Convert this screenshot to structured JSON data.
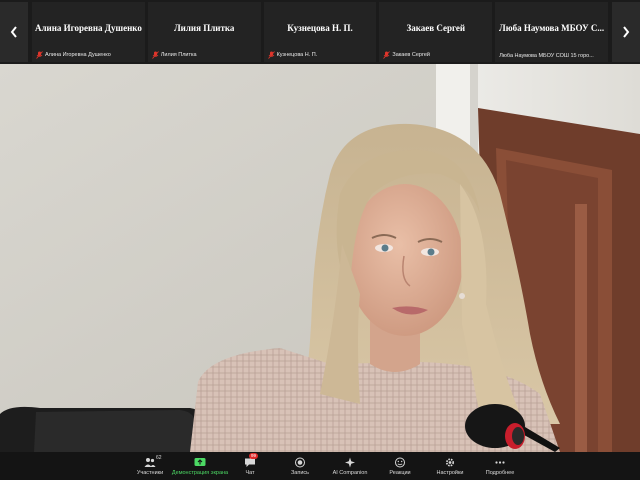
{
  "participants_strip": {
    "prev_icon": "chevron-left-icon",
    "next_icon": "chevron-right-icon",
    "tiles": [
      {
        "display_name": "Алина Игоревна Душенко",
        "label": "Алина Игоревна Душенко",
        "muted": true
      },
      {
        "display_name": "Лилия Плитка",
        "label": "Лилия Плитка",
        "muted": true
      },
      {
        "display_name": "Кузнецова Н. П.",
        "label": "Кузнецова Н. П.",
        "muted": true
      },
      {
        "display_name": "Закаев Сергей",
        "label": "Закаев Сергей",
        "muted": true
      },
      {
        "display_name": "Люба Наумова МБОУ С...",
        "label": "Люба Наумова МБОУ СОШ 15 горо...",
        "muted": false
      }
    ]
  },
  "toolbar": {
    "participants": {
      "label": "Участники",
      "count": "62",
      "icon": "participants-icon"
    },
    "share": {
      "label": "Демонстрация экрана",
      "icon": "share-screen-icon",
      "color": "#4cd964"
    },
    "chat": {
      "label": "Чат",
      "badge": "99",
      "icon": "chat-icon"
    },
    "record": {
      "label": "Запись",
      "icon": "record-icon"
    },
    "ai": {
      "label": "AI Companion",
      "icon": "ai-companion-icon"
    },
    "reactions": {
      "label": "Реакции",
      "icon": "reactions-icon"
    },
    "settings": {
      "label": "Настройки",
      "icon": "gear-icon"
    },
    "more": {
      "label": "Подробнее",
      "icon": "more-icon"
    }
  },
  "colors": {
    "muted_mic": "#e0352b",
    "toolbar_bg": "#141414",
    "strip_bg": "#1b1b1b"
  }
}
